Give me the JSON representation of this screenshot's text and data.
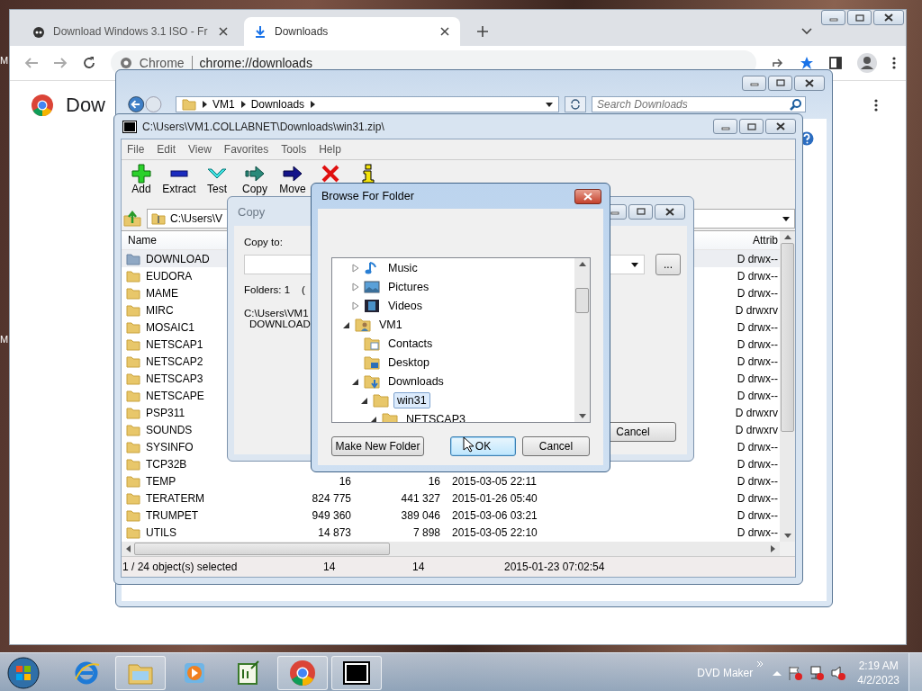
{
  "desktop": {
    "labels": [
      "M",
      "M"
    ]
  },
  "chrome": {
    "tabs": [
      {
        "title": "Download Windows 3.1 ISO - Fr",
        "selected": false
      },
      {
        "title": "Downloads",
        "selected": true
      }
    ],
    "omnibox": {
      "site": "Chrome",
      "url": "chrome://downloads"
    },
    "page_title": "Dow"
  },
  "explorer": {
    "breadcrumb": [
      "VM1",
      "Downloads"
    ],
    "search": {
      "placeholder": "Search Downloads"
    }
  },
  "sevenzip": {
    "title": "C:\\Users\\VM1.COLLABNET\\Downloads\\win31.zip\\",
    "menu": [
      "File",
      "Edit",
      "View",
      "Favorites",
      "Tools",
      "Help"
    ],
    "toolbar": [
      {
        "kind": "add",
        "label": "Add"
      },
      {
        "kind": "extract",
        "label": "Extract"
      },
      {
        "kind": "test",
        "label": "Test"
      },
      {
        "kind": "copy",
        "label": "Copy"
      },
      {
        "kind": "move",
        "label": "Move"
      },
      {
        "kind": "delete"
      },
      {
        "kind": "info"
      }
    ],
    "address": "C:\\Users\\V",
    "columns": [
      "Name",
      "Attrib"
    ],
    "rows": [
      {
        "name": "DOWNLOAD",
        "attrib": "D drwx--",
        "selected": true
      },
      {
        "name": "EUDORA",
        "attrib": "D drwx--",
        "selected": false
      },
      {
        "name": "MAME",
        "attrib": "D drwx--",
        "selected": false
      },
      {
        "name": "MIRC",
        "attrib": "D drwxrv",
        "selected": false
      },
      {
        "name": "MOSAIC1",
        "attrib": "D drwx--",
        "selected": false
      },
      {
        "name": "NETSCAP1",
        "attrib": "D drwx--",
        "selected": false
      },
      {
        "name": "NETSCAP2",
        "attrib": "D drwx--",
        "selected": false
      },
      {
        "name": "NETSCAP3",
        "attrib": "D drwx--",
        "selected": false
      },
      {
        "name": "NETSCAPE",
        "attrib": "D drwx--",
        "selected": false
      },
      {
        "name": "PSP311",
        "attrib": "D drwxrv",
        "selected": false
      },
      {
        "name": "SOUNDS",
        "attrib": "D drwxrv",
        "selected": false
      },
      {
        "name": "SYSINFO",
        "attrib": "D drwx--",
        "selected": false
      },
      {
        "name": "TCP32B",
        "attrib": "D drwx--",
        "selected": false
      },
      {
        "name": "TEMP",
        "size": "16",
        "packed": "16",
        "modified": "2015-03-05 22:11",
        "attrib": "D drwx--",
        "selected": false
      },
      {
        "name": "TERATERM",
        "size": "824 775",
        "packed": "441 327",
        "modified": "2015-01-26 05:40",
        "attrib": "D drwx--",
        "selected": false
      },
      {
        "name": "TRUMPET",
        "size": "949 360",
        "packed": "389 046",
        "modified": "2015-03-06 03:21",
        "attrib": "D drwx--",
        "selected": false
      },
      {
        "name": "UTILS",
        "size": "14 873",
        "packed": "7 898",
        "modified": "2015-03-05 22:10",
        "attrib": "D drwx--",
        "selected": false
      }
    ],
    "status": [
      "1 / 24 object(s) selected",
      "14",
      "14",
      "2015-01-23 07:02:54"
    ]
  },
  "copy_dialog": {
    "title": "Copy",
    "label": "Copy to:",
    "summary": "Folders: 1    (",
    "paths": [
      "C:\\Users\\VM1",
      "DOWNLOAD"
    ],
    "browse_button": "...",
    "cancel_button": "Cancel"
  },
  "browse_dialog": {
    "title": "Browse For Folder",
    "tree": [
      {
        "children": [
          {
            "kind": "music",
            "label": "Music",
            "expanded": false,
            "selected": false
          },
          {
            "kind": "pictures",
            "label": "Pictures",
            "expanded": false,
            "selected": false
          },
          {
            "kind": "videos",
            "label": "Videos",
            "expanded": false,
            "selected": false
          }
        ]
      },
      {
        "kind": "user",
        "label": "VM1",
        "expanded": true,
        "selected": false,
        "children": [
          {
            "kind": "contacts",
            "label": "Contacts",
            "selected": false
          },
          {
            "kind": "desktop",
            "label": "Desktop",
            "selected": false
          },
          {
            "kind": "downloads",
            "label": "Downloads",
            "expanded": true,
            "selected": false,
            "children": [
              {
                "kind": "folder",
                "label": "win31",
                "expanded": true,
                "selected": true,
                "children": [
                  {
                    "kind": "folder",
                    "label": "NETSCAP3",
                    "expanded": true,
                    "selected": false
                  }
                ]
              }
            ]
          }
        ]
      }
    ],
    "buttons": [
      {
        "label": "Make New Folder",
        "focused": false
      },
      {
        "label": "OK",
        "focused": true
      },
      {
        "label": "Cancel",
        "focused": false
      }
    ]
  },
  "taskbar": {
    "apps": [
      {
        "kind": "ie",
        "open": false
      },
      {
        "kind": "explorer",
        "open": true
      },
      {
        "kind": "media",
        "open": false
      },
      {
        "kind": "notepad",
        "open": false
      },
      {
        "kind": "chrome",
        "open": true
      },
      {
        "kind": "sevenzip",
        "open": true
      }
    ],
    "tray_label": "DVD Maker",
    "time": "2:19 AM",
    "date": "4/2/2023"
  }
}
